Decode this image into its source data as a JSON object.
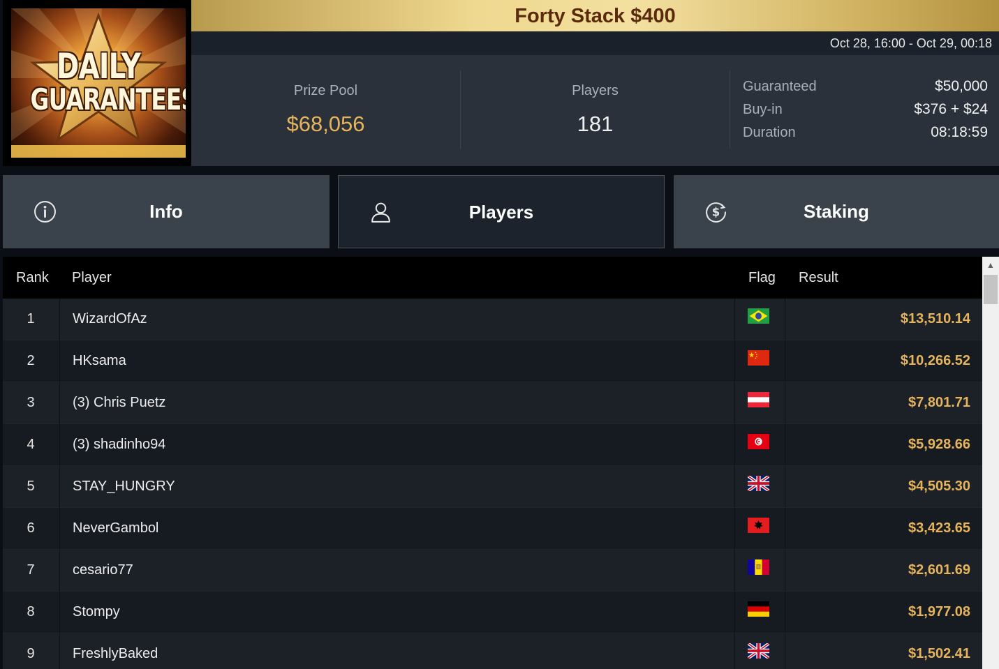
{
  "logo": {
    "line1": "DAILY",
    "line2": "GUARANTEES"
  },
  "header": {
    "title": "Forty Stack $400",
    "date_range": "Oct 28, 16:00 - Oct 29, 00:18"
  },
  "stats": {
    "prize_pool_label": "Prize Pool",
    "prize_pool_value": "$68,056",
    "players_label": "Players",
    "players_value": "181",
    "guaranteed_label": "Guaranteed",
    "guaranteed_value": "$50,000",
    "buyin_label": "Buy-in",
    "buyin_value": "$376 + $24",
    "duration_label": "Duration",
    "duration_value": "08:18:59"
  },
  "tabs": [
    {
      "label": "Info",
      "icon": "info-icon"
    },
    {
      "label": "Players",
      "icon": "user-icon"
    },
    {
      "label": "Staking",
      "icon": "dollar-coin-icon"
    }
  ],
  "active_tab": "Players",
  "table": {
    "headers": {
      "rank": "Rank",
      "player": "Player",
      "flag": "Flag",
      "result": "Result"
    },
    "rows": [
      {
        "rank": "1",
        "player": "WizardOfAz",
        "flag": "brazil",
        "result": "$13,510.14"
      },
      {
        "rank": "2",
        "player": "HKsama",
        "flag": "china",
        "result": "$10,266.52"
      },
      {
        "rank": "3",
        "player": "(3) Chris Puetz",
        "flag": "austria",
        "result": "$7,801.71"
      },
      {
        "rank": "4",
        "player": "(3) shadinho94",
        "flag": "tunisia",
        "result": "$5,928.66"
      },
      {
        "rank": "5",
        "player": "STAY_HUNGRY",
        "flag": "united-kingdom",
        "result": "$4,505.30"
      },
      {
        "rank": "6",
        "player": "NeverGambol",
        "flag": "albania",
        "result": "$3,423.65"
      },
      {
        "rank": "7",
        "player": "cesario77",
        "flag": "andorra",
        "result": "$2,601.69"
      },
      {
        "rank": "8",
        "player": "Stompy",
        "flag": "germany",
        "result": "$1,977.08"
      },
      {
        "rank": "9",
        "player": "FreshlyBaked",
        "flag": "united-kingdom",
        "result": "$1,502.41"
      }
    ]
  },
  "colors": {
    "accent_gold": "#e5b45c",
    "title_text": "#5a2a0c",
    "panel_bg": "#2a313a",
    "tab_bg": "#3a424b",
    "tab_active_bg": "#1d232c"
  }
}
